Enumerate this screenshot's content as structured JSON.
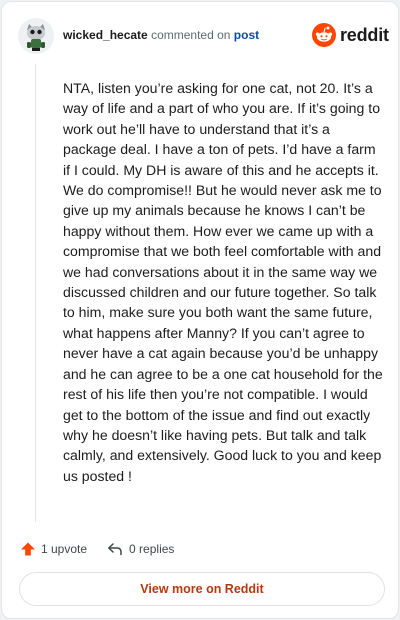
{
  "comment": {
    "username": "wicked_hecate",
    "action_text": "commented on",
    "post_link": "post",
    "body": "NTA, listen you’re asking for one cat, not 20. It’s a way of life and a part of who you are. If it’s going to work out he’ll have to understand that it’s a package deal. I have a ton of pets. I’d have a farm if I could. My DH is aware of this and he accepts it. We do compromise!! But he would never ask me to give up my animals because he knows I can’t be happy without them. How ever we came up with a compromise that we both feel comfortable with and we had conversations about it in the same way we discussed children and our future together. So talk to him, make sure you both want the same future, what happens after Manny? If you can’t agree to never have a cat again because you’d be unhappy and he can agree to be a one cat household for the rest of his life then you’re not compatible. I would get to the bottom of the issue and find out exactly why he doesn’t like having pets. But talk and talk calmly, and extensively. Good luck to you and keep us posted !"
  },
  "brand": {
    "wordmark": "reddit",
    "icon": "reddit-snoo-icon",
    "color": "#ff4500"
  },
  "actions": {
    "upvote_label": "1 upvote",
    "upvote_icon": "upvote-arrow-icon",
    "reply_label": "0 replies",
    "reply_icon": "reply-arrow-icon"
  },
  "footer": {
    "view_more_label": "View more on Reddit"
  },
  "colors": {
    "accent": "#ff4500",
    "link": "#0a4b9e",
    "view_more_text": "#b53a0f"
  }
}
